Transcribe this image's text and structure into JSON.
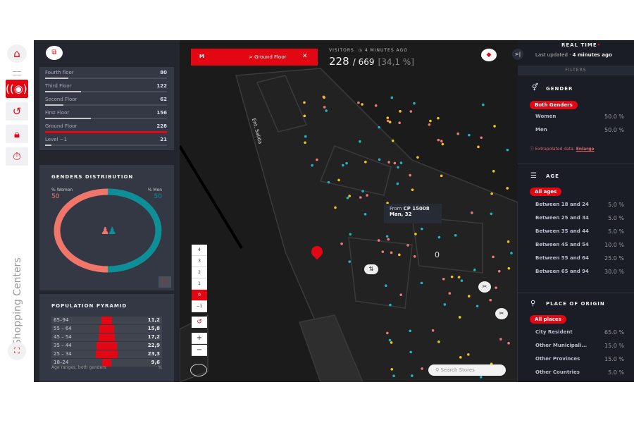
{
  "rail": {
    "items": [
      "home-icon",
      "menu-icon",
      "live-icon",
      "history-icon",
      "shopping-bag-icon",
      "stopwatch-icon"
    ],
    "vertical_label": "Shopping Centers",
    "fullscreen": "fullscreen-icon"
  },
  "floors": [
    {
      "name": "Fourth floor",
      "value": 80
    },
    {
      "name": "Third Floor",
      "value": 122
    },
    {
      "name": "Second Floor",
      "value": 62
    },
    {
      "name": "First Floor",
      "value": 156
    },
    {
      "name": "Ground Floor",
      "value": 228,
      "selected": true
    },
    {
      "name": "Level −1",
      "value": 21
    }
  ],
  "genders": {
    "title": "GENDERS DISTRIBUTION",
    "women_label": "% Women",
    "women_value": "50",
    "men_label": "% Men",
    "men_value": "50",
    "women_color": "#f0766a",
    "men_color": "#0e8f98"
  },
  "pyramid": {
    "title": "POPULATION PYRAMID",
    "footer": "Age ranges, both genders",
    "unit": "%",
    "rows": [
      {
        "range": "65–94",
        "value": "11,2"
      },
      {
        "range": "55 – 64",
        "value": "15,8"
      },
      {
        "range": "45 – 54",
        "value": "17,2"
      },
      {
        "range": "35 – 44",
        "value": "22,9"
      },
      {
        "range": "25 – 34",
        "value": "23,3"
      },
      {
        "range": "18–24",
        "value": "9,6"
      }
    ]
  },
  "map": {
    "breadcrumb_logo": "M",
    "breadcrumb": "> Ground Floor",
    "close": "✕",
    "visitors_label": "VISITORS",
    "time_label": "4 MINUTES AGO",
    "visitors": "228",
    "total": "/ 669",
    "percent": "[34,1 %]",
    "tooltip_from": "From",
    "tooltip_cp": "CP 15008",
    "tooltip_person": "Man, 32",
    "floor_buttons": [
      "4",
      "3",
      "2",
      "1",
      "0",
      "−1"
    ],
    "selected_floor": "0",
    "zoom_in": "+",
    "zoom_out": "−",
    "search_placeholder": "Search Stores",
    "floor_marker": "0",
    "street_label": "Ent. Salida",
    "accent": "#e30613"
  },
  "right": {
    "collapse": ">|",
    "title": "REAL TIME",
    "last_updated": "Last updated",
    "last_updated_value": "4 minutes ago",
    "filters": "FILTERS",
    "gender": {
      "title": "GENDER",
      "pill": "Both Genders",
      "rows": [
        {
          "label": "Women",
          "value": "50.0 %"
        },
        {
          "label": "Men",
          "value": "50.0 %"
        }
      ],
      "note": "Extrapolated data.",
      "note_link": "Enlarge"
    },
    "age": {
      "title": "AGE",
      "pill": "All ages",
      "rows": [
        {
          "label": "Between 18 and 24",
          "value": "5.0 %"
        },
        {
          "label": "Between 25 and 34",
          "value": "5.0 %"
        },
        {
          "label": "Between 35 and 44",
          "value": "5.0 %"
        },
        {
          "label": "Between 45 and 54",
          "value": "10.0 %"
        },
        {
          "label": "Between 55 and 64",
          "value": "25.0 %"
        },
        {
          "label": "Between 65 and 94",
          "value": "30.0 %"
        }
      ]
    },
    "origin": {
      "title": "PLACE OF ORIGIN",
      "pill": "All places",
      "rows": [
        {
          "label": "City Resident",
          "value": "65.0 %"
        },
        {
          "label": "Other Municipali...",
          "value": "15.0 %"
        },
        {
          "label": "Other Provinces",
          "value": "15.0 %"
        },
        {
          "label": "Other Countries",
          "value": "5.0 %"
        }
      ]
    }
  }
}
